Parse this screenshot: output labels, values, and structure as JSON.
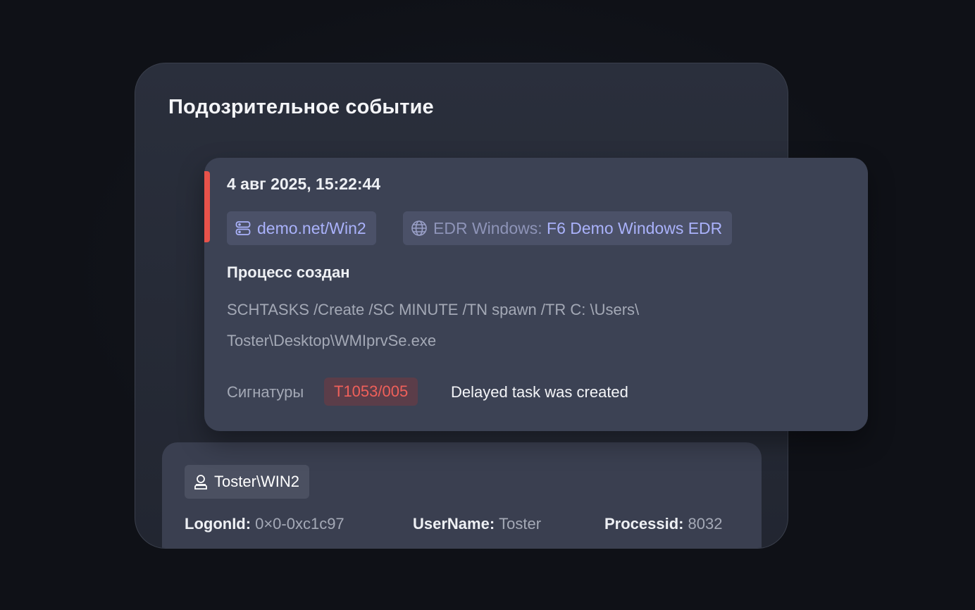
{
  "page": {
    "title": "Подозрительное событие"
  },
  "event": {
    "timestamp": "4 авг 2025, 15:22:44",
    "host": {
      "label": "demo.net/Win2",
      "icon": "server-icon"
    },
    "source": {
      "type": "EDR Windows:",
      "name": "F6 Demo Windows EDR",
      "icon": "globe-icon"
    },
    "name": "Процесс создан",
    "command_line": "SCHTASKS /Create /SC MINUTE /TN spawn /TR C: \\Users\\ Toster\\Desktop\\WMIprvSe.exe",
    "signatures_label": "Сигнатуры",
    "technique": "T1053/005",
    "signature_description": "Delayed task was created",
    "severity_color": "#e8524a"
  },
  "details": {
    "user": {
      "label": "Toster\\WIN2",
      "icon": "user-icon"
    },
    "fields": [
      {
        "key": "LogonId:",
        "value": "0×0-0xc1c97"
      },
      {
        "key": "UserName:",
        "value": "Toster"
      },
      {
        "key": "Processid:",
        "value": "8032"
      }
    ]
  },
  "colors": {
    "background": "#0f1117",
    "card": "#2a2f3c",
    "accent": "#aab2fb",
    "danger": "#e8524a"
  }
}
